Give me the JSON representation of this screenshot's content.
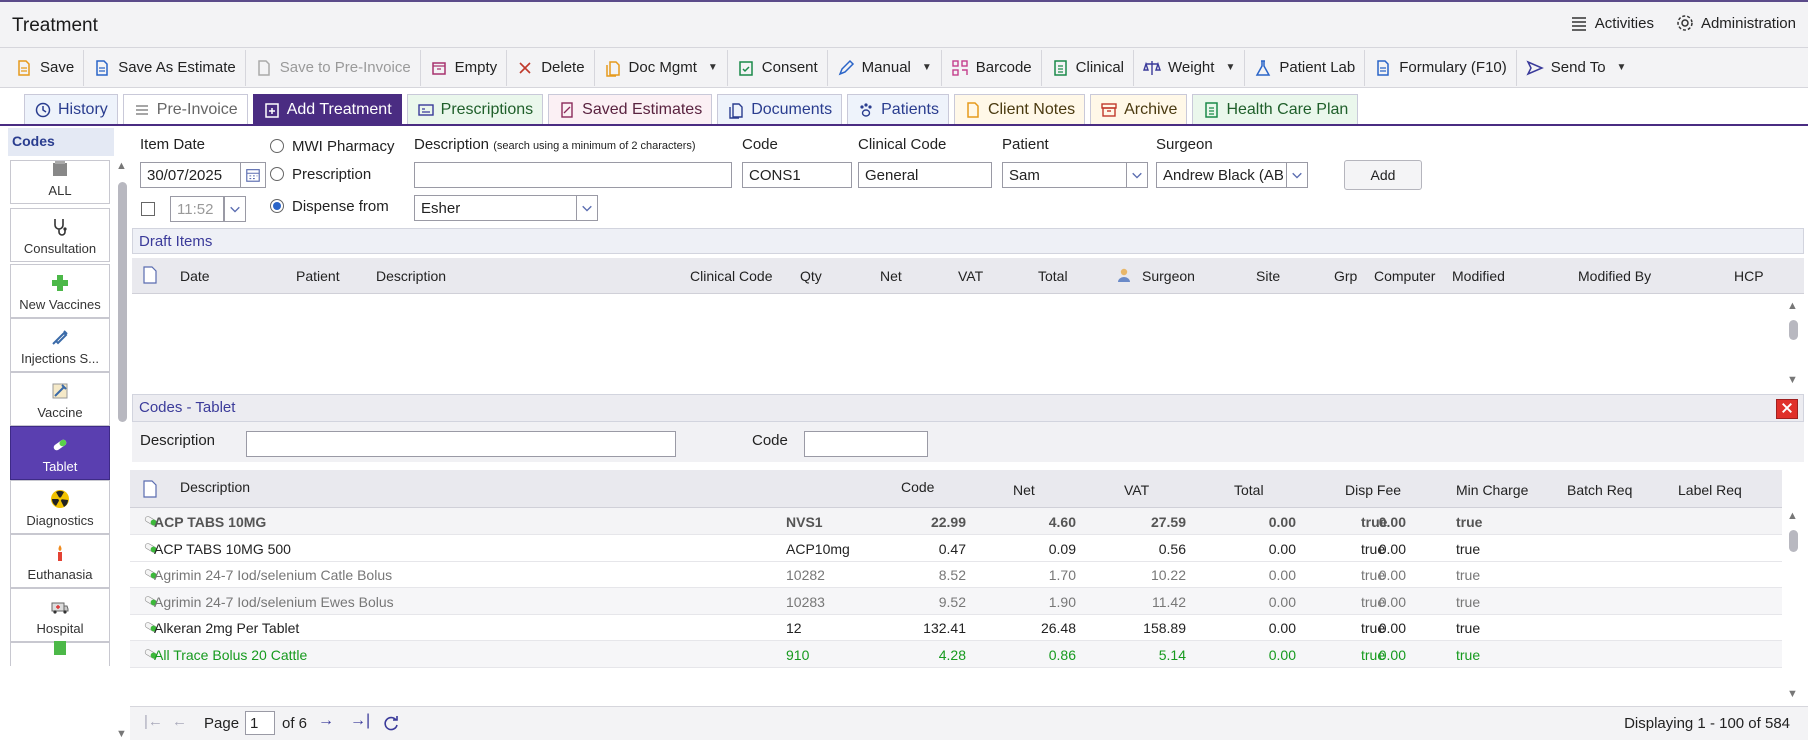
{
  "window": {
    "title": "Treatment"
  },
  "header_right": {
    "activities": "Activities",
    "administration": "Administration"
  },
  "toolbar": {
    "save": "Save",
    "save_as_estimate": "Save As Estimate",
    "save_to_pre_invoice": "Save to Pre-Invoice",
    "empty": "Empty",
    "delete": "Delete",
    "doc_mgmt": "Doc Mgmt",
    "consent": "Consent",
    "manual": "Manual",
    "barcode": "Barcode",
    "clinical": "Clinical",
    "weight": "Weight",
    "patient_lab": "Patient Lab",
    "formulary": "Formulary (F10)",
    "send_to": "Send To"
  },
  "tabs": [
    "History",
    "Pre-Invoice",
    "Add Treatment",
    "Prescriptions",
    "Saved Estimates",
    "Documents",
    "Patients",
    "Client Notes",
    "Archive",
    "Health Care Plan"
  ],
  "sidebar": {
    "header": "Codes",
    "items": [
      "ALL",
      "Consultation",
      "New Vaccines",
      "Injections S...",
      "Vaccine",
      "Tablet",
      "Diagnostics",
      "Euthanasia",
      "Hospital"
    ]
  },
  "form": {
    "item_date_label": "Item Date",
    "item_date_value": "30/07/2025",
    "time_value": "11:52",
    "mwi_pharmacy": "MWI Pharmacy",
    "prescription": "Prescription",
    "dispense_from": "Dispense from",
    "dispense_value": "Esher",
    "description_label": "Description",
    "description_hint": "(search using a minimum of 2 characters)",
    "description_value": "",
    "code_label": "Code",
    "code_value": "CONS1",
    "clinical_code_label": "Clinical Code",
    "clinical_code_value": "General",
    "patient_label": "Patient",
    "patient_value": "Sam",
    "surgeon_label": "Surgeon",
    "surgeon_value": "Andrew Black (AB)",
    "add_button": "Add"
  },
  "draft": {
    "title": "Draft Items",
    "columns": [
      "Date",
      "Patient",
      "Description",
      "Clinical Code",
      "Qty",
      "Net",
      "VAT",
      "Total",
      "Surgeon",
      "Site",
      "Grp",
      "Computer",
      "Modified",
      "Modified By",
      "HCP"
    ]
  },
  "codes": {
    "title": "Codes - Tablet",
    "description_label": "Description",
    "code_label": "Code",
    "description_value": "",
    "code_value": "",
    "columns": [
      "Description",
      "Code",
      "Net",
      "VAT",
      "Total",
      "Disp Fee",
      "Min Charge",
      "Batch Req",
      "Label Req"
    ],
    "rows": [
      {
        "desc": "ACP TABS 10MG",
        "code": "NVS1",
        "net": "22.99",
        "vat": "4.60",
        "total": "27.59",
        "disp": "0.00",
        "min": "0.00",
        "batch": "true",
        "label": "true",
        "style": "bold"
      },
      {
        "desc": "ACP TABS 10MG 500",
        "code": "ACP10mg",
        "net": "0.47",
        "vat": "0.09",
        "total": "0.56",
        "disp": "0.00",
        "min": "0.00",
        "batch": "true",
        "label": "true",
        "style": "normal"
      },
      {
        "desc": "Agrimin 24-7 Iod/selenium Catle Bolus",
        "code": "10282",
        "net": "8.52",
        "vat": "1.70",
        "total": "10.22",
        "disp": "0.00",
        "min": "0.00",
        "batch": "true",
        "label": "true",
        "style": "grey"
      },
      {
        "desc": "Agrimin 24-7 Iod/selenium Ewes Bolus",
        "code": "10283",
        "net": "9.52",
        "vat": "1.90",
        "total": "11.42",
        "disp": "0.00",
        "min": "0.00",
        "batch": "true",
        "label": "true",
        "style": "grey alt"
      },
      {
        "desc": "Alkeran 2mg Per Tablet",
        "code": "12",
        "net": "132.41",
        "vat": "26.48",
        "total": "158.89",
        "disp": "0.00",
        "min": "0.00",
        "batch": "true",
        "label": "true",
        "style": "normal"
      },
      {
        "desc": "All Trace Bolus 20 Cattle",
        "code": "910",
        "net": "4.28",
        "vat": "0.86",
        "total": "5.14",
        "disp": "0.00",
        "min": "0.00",
        "batch": "true",
        "label": "true",
        "style": "green"
      }
    ]
  },
  "pager": {
    "page_label": "Page",
    "page_value": "1",
    "of_label": "of 6",
    "displaying": "Displaying 1 - 100 of 584"
  }
}
